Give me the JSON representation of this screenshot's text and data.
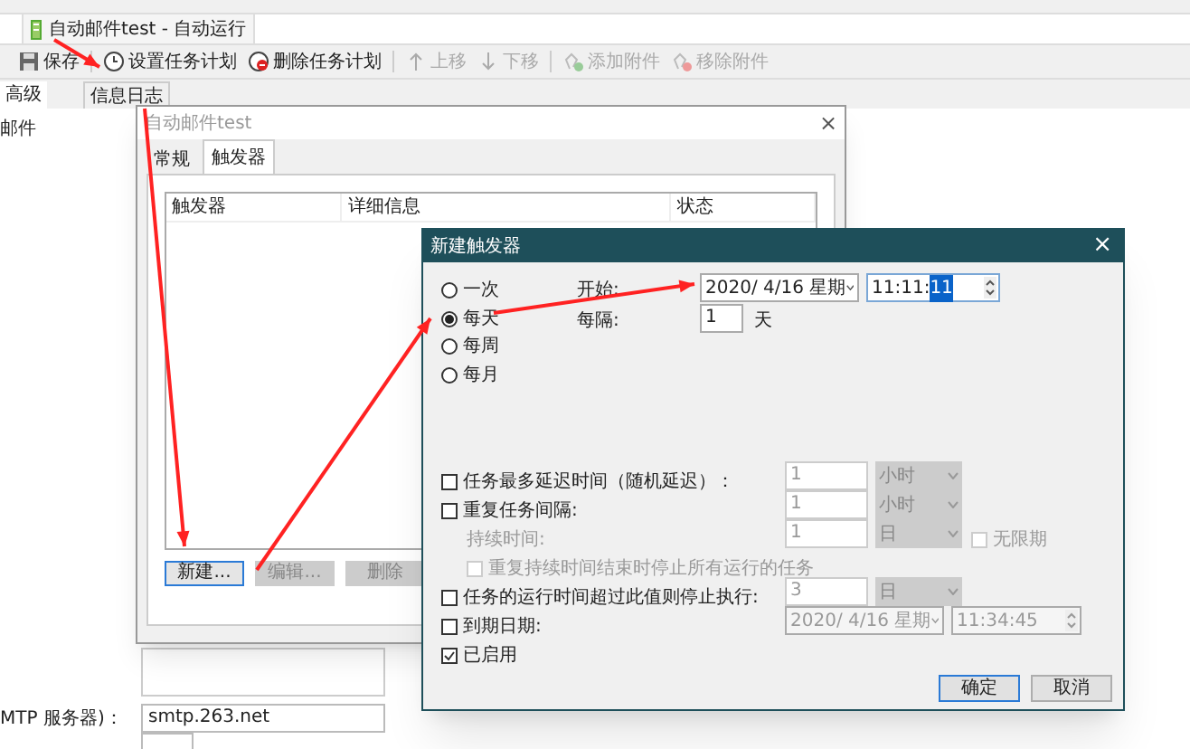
{
  "app_tab": {
    "title": "自动邮件test - 自动运行"
  },
  "toolbar": [
    {
      "label": "保存",
      "disabled": false
    },
    {
      "label": "设置任务计划",
      "disabled": false
    },
    {
      "label": "删除任务计划",
      "disabled": false
    },
    {
      "label": "上移",
      "disabled": true
    },
    {
      "label": "下移",
      "disabled": true
    },
    {
      "label": "添加附件",
      "disabled": true
    },
    {
      "label": "移除附件",
      "disabled": true
    }
  ],
  "view_tabs": [
    {
      "label": "高级",
      "selected": true
    },
    {
      "label": "信息日志",
      "selected": false
    }
  ],
  "form": {
    "label_1": "邮件",
    "smtp_label": "MTP 服务器)：",
    "smtp_value": "smtp.263.net"
  },
  "task_dialog": {
    "title": "自动邮件test",
    "close": "×",
    "tabs": [
      {
        "label": "常规",
        "selected": false
      },
      {
        "label": "触发器",
        "selected": true
      }
    ],
    "columns": [
      "触发器",
      "详细信息",
      "状态"
    ],
    "buttons": [
      {
        "label": "新建...",
        "disabled": false
      },
      {
        "label": "编辑...",
        "disabled": true
      },
      {
        "label": "删除",
        "disabled": true
      }
    ]
  },
  "trigger_dialog": {
    "title": "新建触发器",
    "close": "×",
    "schedule": [
      {
        "label": "一次",
        "selected": false
      },
      {
        "label": "每天",
        "selected": true
      },
      {
        "label": "每周",
        "selected": false
      },
      {
        "label": "每月",
        "selected": false
      }
    ],
    "start_label": "开始:",
    "start_date": "2020/ 4/16 星期",
    "time_value": "11:11:",
    "time_selected": "11",
    "interval_label": "每隔:",
    "interval_value": "1",
    "interval_unit": "天",
    "options": [
      {
        "kind": "checkbox",
        "label": "任务最多延迟时间（随机延迟）：",
        "checked": false,
        "value": "1",
        "unit": "小时"
      },
      {
        "kind": "checkbox",
        "label": "重复任务间隔:",
        "checked": false,
        "value": "1",
        "unit": "小时"
      },
      {
        "kind": "sub",
        "label": "持续时间:",
        "value": "1",
        "unit": "日",
        "extra": {
          "label": "无限期",
          "checked": false
        }
      },
      {
        "kind": "subcheck",
        "label": "重复持续时间结束时停止所有运行的任务",
        "checked": false
      },
      {
        "kind": "checkbox",
        "label": "任务的运行时间超过此值则停止执行:",
        "checked": false,
        "value": "3",
        "unit": "日"
      },
      {
        "kind": "expiry",
        "label": "到期日期:",
        "checked": false,
        "date": "2020/ 4/16 星期",
        "time": "11:34:45"
      },
      {
        "kind": "checkbox",
        "label": "已启用",
        "checked": true
      }
    ],
    "buttons": [
      {
        "label": "确定",
        "default": true
      },
      {
        "label": "取消",
        "default": false
      }
    ]
  }
}
